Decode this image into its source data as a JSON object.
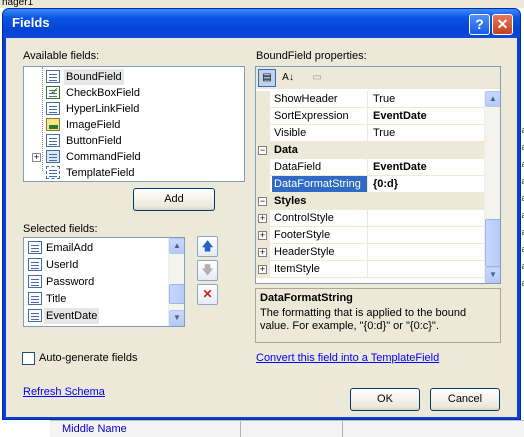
{
  "background": {
    "top_fragment": "nager1",
    "bottom_cell": "Middle Name",
    "right_letters": [
      "Da",
      "Da",
      "Da",
      "Da",
      "Da",
      "Da",
      "Da",
      "Da",
      "Da",
      "Da"
    ]
  },
  "window": {
    "title": "Fields",
    "help_glyph": "?",
    "close_glyph": "✕"
  },
  "available": {
    "label": "Available fields:",
    "items": [
      {
        "label": "BoundField",
        "icon": "bound-field-icon"
      },
      {
        "label": "CheckBoxField",
        "icon": "checkbox-field-icon"
      },
      {
        "label": "HyperLinkField",
        "icon": "hyperlink-field-icon"
      },
      {
        "label": "ImageField",
        "icon": "image-field-icon"
      },
      {
        "label": "ButtonField",
        "icon": "button-field-icon"
      },
      {
        "label": "CommandField",
        "icon": "command-field-icon"
      },
      {
        "label": "TemplateField",
        "icon": "template-field-icon"
      }
    ],
    "expander_glyph": "+",
    "add_label": "Add"
  },
  "selected": {
    "label": "Selected fields:",
    "items": [
      "EmailAdd",
      "UserId",
      "Password",
      "Title",
      "EventDate"
    ],
    "move_up_glyph": "🡅",
    "move_down_glyph": "🡇",
    "delete_glyph": "✕"
  },
  "auto_generate": {
    "label": "Auto-generate fields",
    "checked": false
  },
  "refresh_link": "Refresh Schema",
  "properties": {
    "label": "BoundField properties:",
    "toolbar": {
      "categorized_glyph": "▤",
      "alphabetical_glyph": "A↓",
      "pages_glyph": "▭"
    },
    "rows": [
      {
        "name": "ShowHeader",
        "value": "True",
        "bold": false
      },
      {
        "name": "SortExpression",
        "value": "EventDate",
        "bold": true
      },
      {
        "name": "Visible",
        "value": "True",
        "bold": false
      }
    ],
    "data_category": "Data",
    "data_rows": [
      {
        "name": "DataField",
        "value": "EventDate",
        "bold": true
      },
      {
        "name": "DataFormatString",
        "value": "{0:d}",
        "bold": true
      }
    ],
    "styles_category": "Styles",
    "style_rows": [
      "ControlStyle",
      "FooterStyle",
      "HeaderStyle",
      "ItemStyle"
    ],
    "collapse_glyph": "−",
    "expand_glyph": "+",
    "description": {
      "title": "DataFormatString",
      "text": "The formatting that is applied to the bound value. For example, \"{0:d}\" or \"{0:c}\"."
    }
  },
  "convert_link": "Convert this field into a TemplateField",
  "buttons": {
    "ok": "OK",
    "cancel": "Cancel"
  },
  "scroll_glyphs": {
    "up": "▲",
    "down": "▼"
  }
}
